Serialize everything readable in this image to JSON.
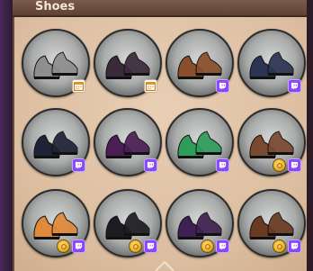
{
  "header": {
    "title": "Shoes"
  },
  "colors": {
    "twitch": "#8a48f5",
    "coin": "#f1b52a",
    "panel": "#dcbd9f"
  },
  "items": [
    {
      "name": "shoe-gray-clogs",
      "badges": [
        "calendar"
      ],
      "color": "#8e8e8e"
    },
    {
      "name": "shoe-purple-strappy-boots",
      "badges": [
        "calendar"
      ],
      "color": "#3a2a3c"
    },
    {
      "name": "shoe-brown-sandals",
      "badges": [
        "twitch"
      ],
      "color": "#8a4f2a"
    },
    {
      "name": "shoe-dark-blue-boots",
      "badges": [
        "twitch"
      ],
      "color": "#2b3452"
    },
    {
      "name": "shoe-tall-black-boots",
      "badges": [
        "twitch"
      ],
      "color": "#1f2336"
    },
    {
      "name": "shoe-purple-slippers",
      "badges": [
        "twitch"
      ],
      "color": "#4b1f54"
    },
    {
      "name": "shoe-green-gold-heels",
      "badges": [
        "twitch"
      ],
      "color": "#2f9c5a"
    },
    {
      "name": "shoe-brown-strap-sandals",
      "badges": [
        "coin",
        "twitch"
      ],
      "color": "#7a4a30"
    },
    {
      "name": "shoe-white-orange-loafers",
      "badges": [
        "coin",
        "twitch"
      ],
      "color": "#e08a3a"
    },
    {
      "name": "shoe-black-buckle-boots",
      "badges": [
        "coin",
        "twitch"
      ],
      "color": "#1c1c22"
    },
    {
      "name": "shoe-purple-black-heels",
      "badges": [
        "coin",
        "twitch"
      ],
      "color": "#402050"
    },
    {
      "name": "shoe-brown-lace-boots",
      "badges": [
        "coin",
        "twitch"
      ],
      "color": "#6a3a22"
    }
  ]
}
